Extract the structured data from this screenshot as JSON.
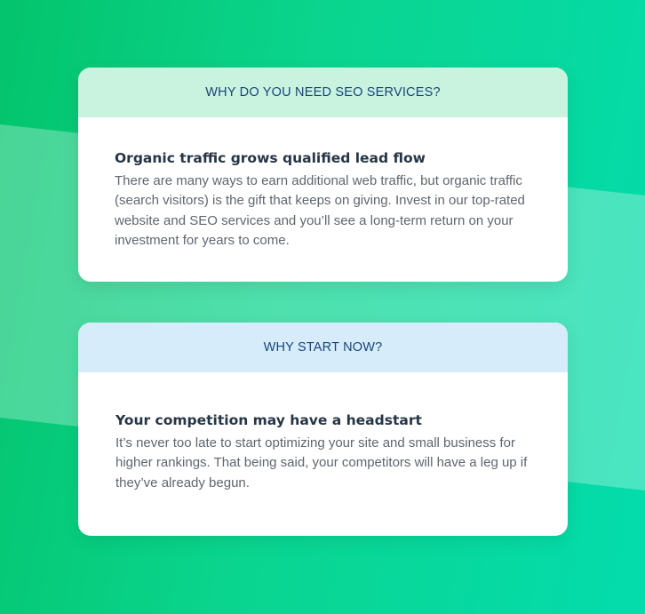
{
  "cards": [
    {
      "header": "WHY DO YOU NEED SEO SERVICES?",
      "title": "Organic traffic grows qualified lead flow",
      "text": "There are many ways to earn additional web traffic, but organic traffic (search visitors) is the gift that keeps on giving. Invest in our top-rated website and SEO services and you’ll see a long-term return on your investment for years to come."
    },
    {
      "header": "WHY START NOW?",
      "title": "Your competition may have a headstart",
      "text": "It’s never too late to start optimizing your site and small business for higher rankings. That being said, your competitors will have a leg up if they’ve already begun."
    }
  ],
  "colors": {
    "background_start": "#04c46c",
    "background_end": "#04dcad",
    "header_green": "#c9f3df",
    "header_blue": "#d6ecfb",
    "header_text": "#17457a",
    "title_text": "#263545",
    "body_text": "#5f6670"
  }
}
